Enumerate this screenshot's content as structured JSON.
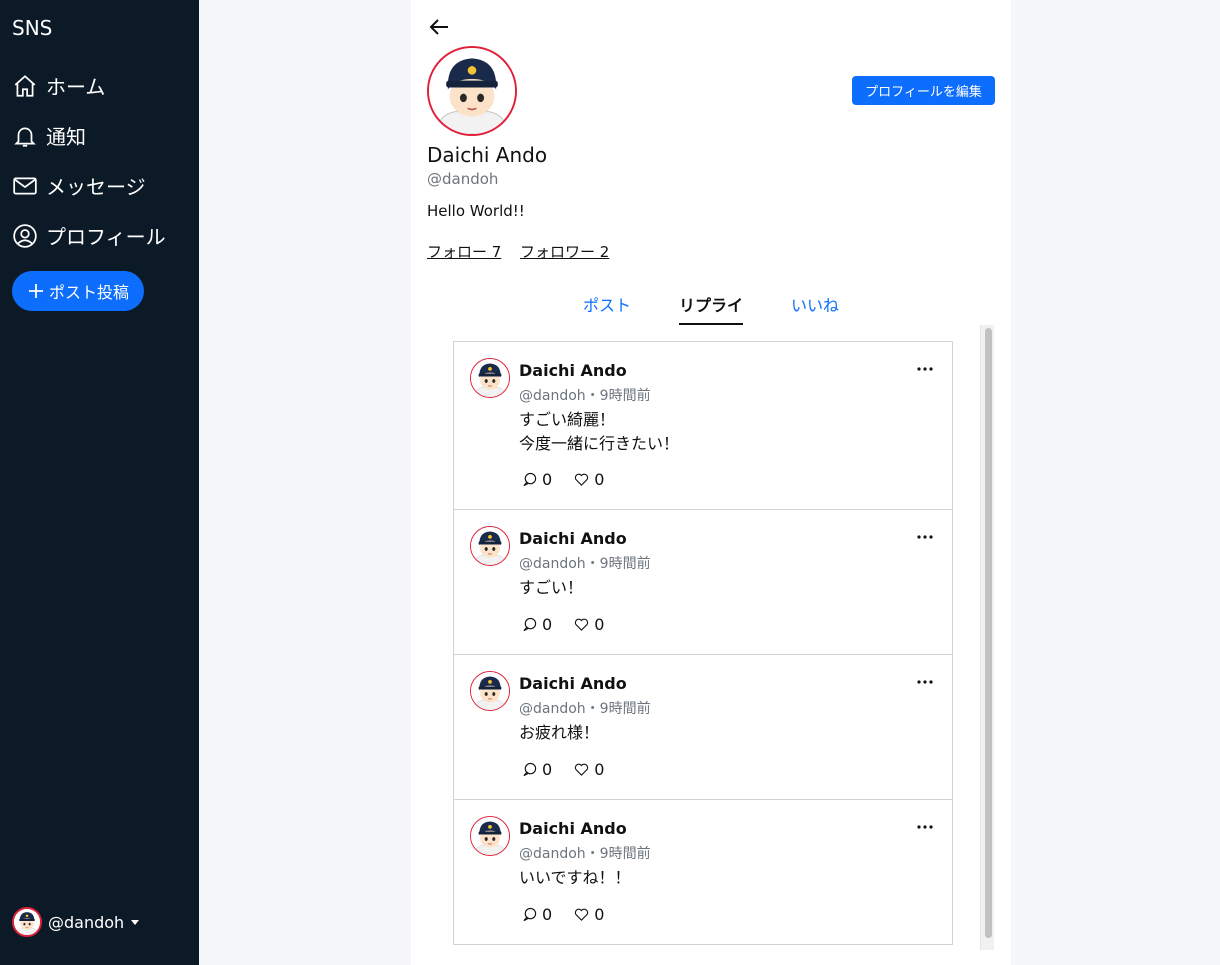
{
  "sidebar": {
    "brand": "SNS",
    "items": [
      {
        "label": "ホーム",
        "icon": "home-icon"
      },
      {
        "label": "通知",
        "icon": "bell-icon"
      },
      {
        "label": "メッセージ",
        "icon": "envelope-icon"
      },
      {
        "label": "プロフィール",
        "icon": "person-circle-icon"
      }
    ],
    "post_button": "ポスト投稿",
    "user": "@dandoh"
  },
  "profile": {
    "edit_button": "プロフィールを編集",
    "name": "Daichi Ando",
    "handle": "@dandoh",
    "bio": "Hello World!!",
    "following": "フォロー 7",
    "followers": "フォロワー 2"
  },
  "tabs": [
    {
      "label": "ポスト",
      "active": false
    },
    {
      "label": "リプライ",
      "active": true
    },
    {
      "label": "いいね",
      "active": false
    }
  ],
  "posts": [
    {
      "name": "Daichi Ando",
      "meta": "@dandoh・9時間前",
      "body": "すごい綺麗！\n今度一緒に行きたい！",
      "replies": "0",
      "likes": "0"
    },
    {
      "name": "Daichi Ando",
      "meta": "@dandoh・9時間前",
      "body": "すごい！",
      "replies": "0",
      "likes": "0"
    },
    {
      "name": "Daichi Ando",
      "meta": "@dandoh・9時間前",
      "body": "お疲れ様！",
      "replies": "0",
      "likes": "0"
    },
    {
      "name": "Daichi Ando",
      "meta": "@dandoh・9時間前",
      "body": "いいですね！！",
      "replies": "0",
      "likes": "0"
    }
  ],
  "colors": {
    "sidebar": "#0c1a27",
    "accent": "#0d6efd",
    "avatar_ring": "#e0203a"
  }
}
